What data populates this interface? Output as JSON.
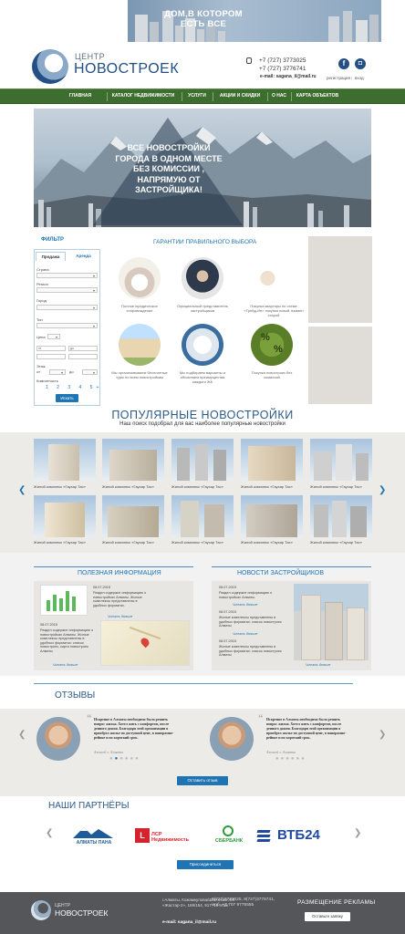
{
  "promo": {
    "text": "ДОМ,В КОТОРОМ ЕСТЬ ВСЕ"
  },
  "header": {
    "logo_top": "ЦЕНТР",
    "logo_main": "НОВОСТРОЕК",
    "phone1": "+7 (727) 3773025",
    "phone2": "+7 (727) 3776741",
    "email": "e-mail: sagana_il@mail.ru",
    "facebook": "f",
    "instagram": "◘",
    "register": "регистрация",
    "login": "вход"
  },
  "nav": {
    "items": [
      "ГЛАВНАЯ",
      "КАТАЛОГ НЕДВИЖИМОСТИ",
      "УСЛУГИ",
      "АКЦИИ И СКИДКИ",
      "О НАС",
      "КАРТА ОБЪЕКТОВ"
    ]
  },
  "hero": {
    "text": "ВСЕ НОВОСТРОЙКИ ГОРОДА В ОДНОМ МЕСТЕ БЕЗ КОМИССИИ , НАПРЯМУЮ ОТ ЗАСТРОЙЩИКА!"
  },
  "filter": {
    "title": "ФИЛЬТР",
    "tab_sale": "Продажа",
    "tab_rent": "Аренда",
    "country": "Страна",
    "region": "Регион",
    "city": "Город",
    "type": "Тип",
    "price": "Цена",
    "from": "от",
    "to": "до",
    "floor": "Этаж",
    "floor_from": "от",
    "floor_to": "до",
    "rooms": "Комнатность",
    "pages": "1 2 3 4 5+",
    "search": "Искать"
  },
  "guarantees": {
    "title": "ГАРАНТИИ ПРАВИЛЬНОГО ВЫБОРА",
    "items": [
      "Полное юридическое сопровождение",
      "Официальный представитель застройщиков",
      "Покупка квартиры по схеме «Трейд-Ин» покупка новой, взамен старой",
      "Мы организовываем бесплатные туры по всем новостройкам",
      "Мы подбираем варианты и объясняем преимущества каждого ЖК",
      "Покупка новостроек без комиссий"
    ]
  },
  "popular": {
    "title": "ПОПУЛЯРНЫЕ НОВОСТРОЙКИ",
    "subtitle": "Наш поиск подобрал для вас наиболее популярные новостройки",
    "caption": "Жилой комплекс «Гаухар Тас»",
    "left_arrow": "❮",
    "right_arrow": "❯"
  },
  "useful": {
    "title": "ПОЛЕЗНАЯ ИНФОРМАЦИЯ",
    "date": "08.07.2015",
    "text1": "Раздел содержит информацию о новостройках Алматы. Жилые комплексы представлены в удобных форматах.",
    "text2": "Раздел содержит информацию о новостройках Алматы. Жилые комплексы представлены в удобных форматах: список новостроек, карта новостроек Алматы",
    "more": "Читать дальше"
  },
  "news": {
    "title": "НОВОСТИ ЗАСТРОЙЩИКОВ",
    "date": "08.07.2015",
    "text1": "Раздел содержит информацию о новостройках Алматы.",
    "text2": "Жилые комплексы представлены в удобных форматах: список новостроек Алматы",
    "text3": "Жилые комплексы представлены в удобных форматах: список новостроек Алматы",
    "more": "Читать дальше"
  },
  "reviews": {
    "title": "ОТЗЫВЫ",
    "text": "Искренне в Алматы необходимо было решить вопрос жилья. Хотел жить с комфортом, после денного дожия. Благодаря этой организации я приобрел жилье по доступной цене, в панорамно-рейнке и по короткий срок.",
    "name": "Алексей г. Алматы",
    "button": "Оставить отзыв"
  },
  "partners": {
    "title": "НАШИ ПАРТНЁРЫ",
    "button": "Присоединиться",
    "names": [
      "АЛМАТЫ ПАНА",
      "ЛСР Недвижимость",
      "СБЕРБАНК",
      "ВТБ24"
    ]
  },
  "footer": {
    "logo_top": "ЦЕНТР",
    "logo_main": "НОВОСТРОЕК",
    "address": "г.Алматы, Кожамкулова/Шевченко ЖК «Жастар-2», 169/154, 917, 19 этаж",
    "email": "e-mail: sagana_il@mail.ru",
    "phones": "8(727)3773025, 8(727)3776741, моб. +7 707 9775555",
    "ads": "РАЗМЕЩЕНИЕ РЕКЛАМЫ",
    "button": "Оставьте заявку"
  },
  "colors": {
    "nav": "#3d6e2f",
    "accent": "#1f74b4",
    "footer": "#55565a"
  }
}
